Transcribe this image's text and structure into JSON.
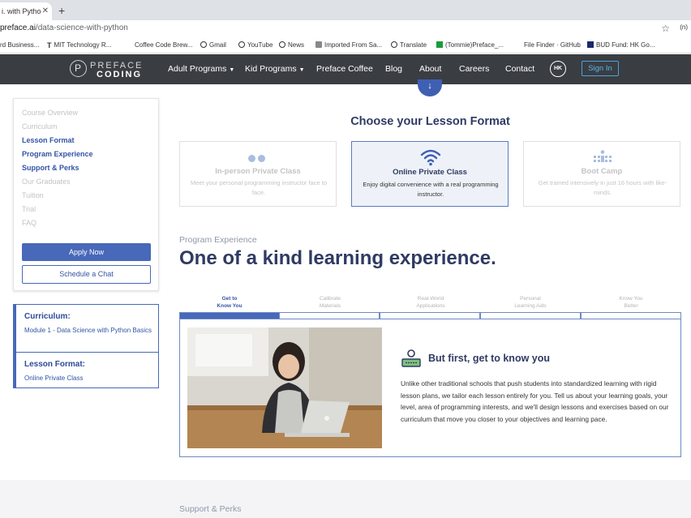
{
  "browser": {
    "tab_title": "i. with Pytho",
    "url_host": "preface.ai",
    "url_path": "/data-science-with-python",
    "bookmarks": [
      "rd Business...",
      "MIT Technology R...",
      "Coffee Code Brew...",
      "Gmail",
      "YouTube",
      "News",
      "Imported From Sa...",
      "Translate",
      "(Tommie)Preface_...",
      "File Finder · GitHub",
      "BUD Fund: HK Go..."
    ],
    "ext_label": "(n)"
  },
  "nav": {
    "logo_line1": "PREFACE",
    "logo_line2": "CODING",
    "links": [
      "Adult Programs",
      "Kid Programs",
      "Preface Coffee",
      "Blog",
      "About",
      "Careers",
      "Contact"
    ],
    "avatar_initials": "HK",
    "sign_in": "Sign In"
  },
  "sidebar": {
    "items": [
      {
        "label": "Course Overview",
        "active": false
      },
      {
        "label": "Curriculum",
        "active": false
      },
      {
        "label": "Lesson Format",
        "active": true
      },
      {
        "label": "Program Experience",
        "active": true
      },
      {
        "label": "Support & Perks",
        "active": true
      },
      {
        "label": "Our Graduates",
        "active": false
      },
      {
        "label": "Tuition",
        "active": false
      },
      {
        "label": "Trial",
        "active": false
      },
      {
        "label": "FAQ",
        "active": false
      }
    ],
    "apply_label": "Apply Now",
    "chat_label": "Schedule a Chat"
  },
  "summary": {
    "curriculum_heading": "Curriculum:",
    "curriculum_value": "Module 1 - Data Science with Python Basics",
    "format_heading": "Lesson Format:",
    "format_value": "Online Private Class"
  },
  "lesson_format": {
    "title": "Choose your Lesson Format",
    "cards": [
      {
        "title": "In-person Private Class",
        "desc": "Meet your personal programming instructor face to face.",
        "selected": false,
        "icon": "two-dots-icon"
      },
      {
        "title": "Online Private Class",
        "desc": "Enjoy digital convenience with a real programming instructor.",
        "selected": true,
        "icon": "wifi-icon"
      },
      {
        "title": "Boot Camp",
        "desc": "Get trained intensively in just 16 hours with like-minds.",
        "selected": false,
        "icon": "group-dots-icon"
      }
    ]
  },
  "program_experience": {
    "label": "Program Experience",
    "heading": "One of a kind learning experience.",
    "steps": [
      {
        "line1": "Get to",
        "line2": "Know You",
        "active": true
      },
      {
        "line1": "Calibrate",
        "line2": "Materials",
        "active": false
      },
      {
        "line1": "Real-World",
        "line2": "Applications",
        "active": false
      },
      {
        "line1": "Personal",
        "line2": "Learning Aids",
        "active": false
      },
      {
        "line1": "Know You",
        "line2": "Better",
        "active": false
      }
    ],
    "panel_title": "But first, get to know you",
    "panel_body": "Unlike other traditional schools that push students into standardized learning with rigid lesson plans, we tailor each lesson entirely for you. Tell us about your learning goals, your level, area of programming interests, and we'll design lessons and exercises based on our curriculum that move you closer to your objectives and learning pace."
  },
  "support": {
    "label": "Support & Perks"
  },
  "colors": {
    "brand_blue": "#4868b9",
    "heading_navy": "#2f3b63",
    "nav_bg": "#3a3d42"
  }
}
